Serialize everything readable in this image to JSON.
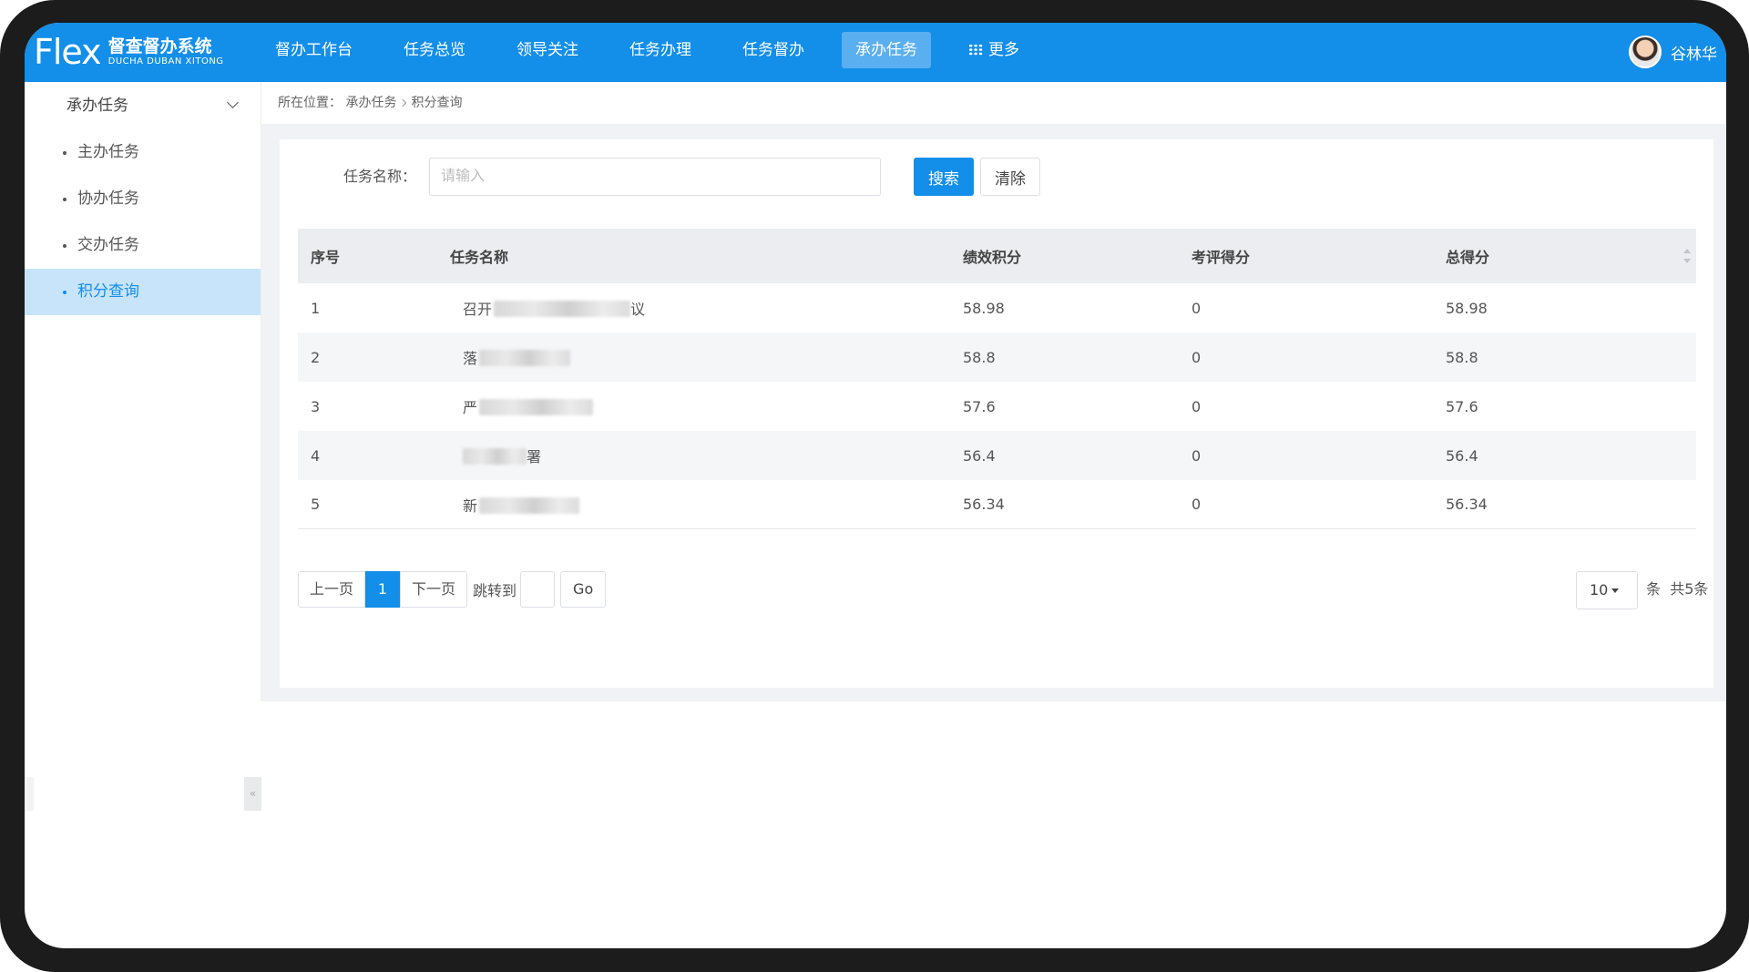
{
  "header": {
    "logo_mark": "Flex",
    "logo_cn": "督查督办系统",
    "logo_en": "DUCHA DUBAN XITONG",
    "nav": [
      "督办工作台",
      "任务总览",
      "领导关注",
      "任务办理",
      "任务督办",
      "承办任务"
    ],
    "nav_active": "承办任务",
    "more_label": "更多",
    "user_name": "谷林华"
  },
  "sidebar": {
    "group_title": "承办任务",
    "items": [
      "主办任务",
      "协办任务",
      "交办任务",
      "积分查询"
    ],
    "active": "积分查询"
  },
  "breadcrumb": {
    "prefix": "所在位置：",
    "parent": "承办任务",
    "current": "积分查询"
  },
  "search": {
    "label": "任务名称：",
    "placeholder": "请输入",
    "search_button": "搜索",
    "clear_button": "清除"
  },
  "table": {
    "columns": [
      "序号",
      "任务名称",
      "绩效积分",
      "考评得分",
      "总得分"
    ],
    "rows": [
      {
        "no": "1",
        "name_start": "召开",
        "name_end": "议",
        "perf": "58.98",
        "eval": "0",
        "total": "58.98"
      },
      {
        "no": "2",
        "name_start": "落",
        "name_end": "",
        "perf": "58.8",
        "eval": "0",
        "total": "58.8"
      },
      {
        "no": "3",
        "name_start": "严",
        "name_end": "",
        "perf": "57.6",
        "eval": "0",
        "total": "57.6"
      },
      {
        "no": "4",
        "name_start": "",
        "name_end": "署",
        "perf": "56.4",
        "eval": "0",
        "total": "56.4"
      },
      {
        "no": "5",
        "name_start": "新",
        "name_end": "",
        "perf": "56.34",
        "eval": "0",
        "total": "56.34"
      }
    ]
  },
  "pagination": {
    "prev": "上一页",
    "current_page": "1",
    "next": "下一页",
    "jump_label": "跳转到",
    "go": "Go",
    "page_size": "10",
    "unit": "条",
    "total": "共5条"
  }
}
